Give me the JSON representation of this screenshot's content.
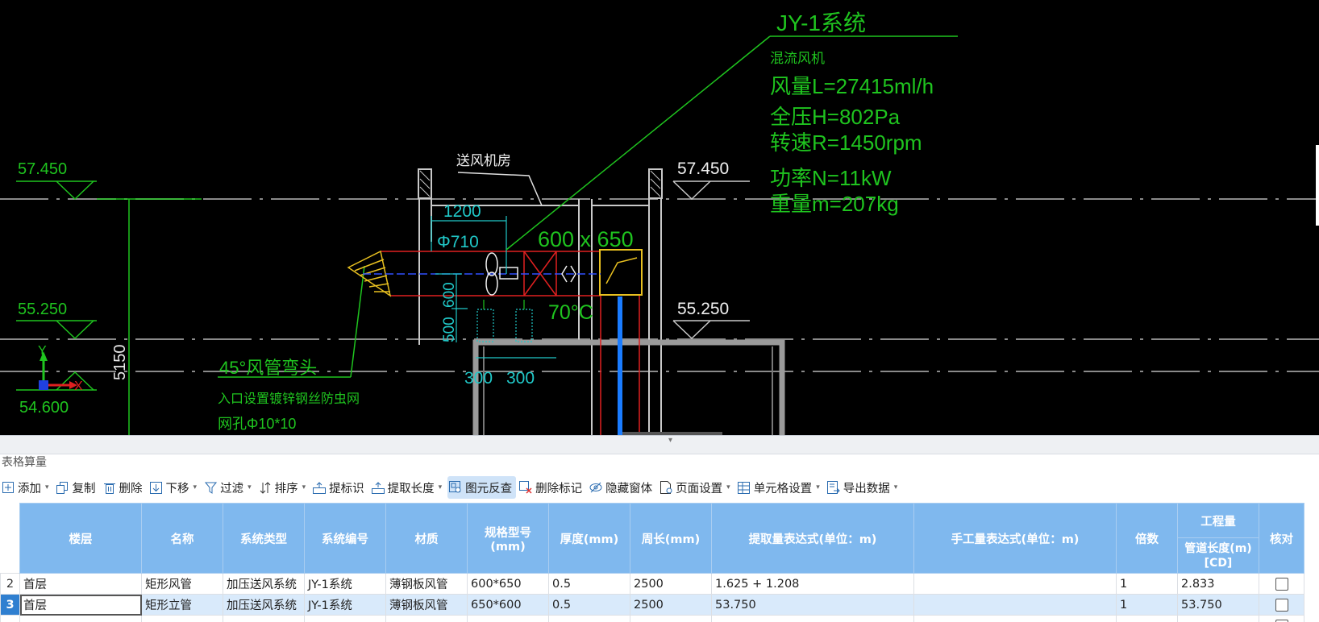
{
  "drawing": {
    "system_title": "JY-1系统",
    "fan_type": "混流风机",
    "airflow": "风量L=27415ml/h",
    "pressure": "全压H=802Pa",
    "speed": "转速R=1450rpm",
    "power": "功率N=11kW",
    "weight": "重量m=207kg",
    "room_label": "送风机房",
    "level_top": "57.450",
    "level_mid": "55.250",
    "level_bot": "54.600",
    "vertical_dim": "5150",
    "dim_1200": "1200",
    "dia_710": "Φ710",
    "duct_size": "600 x 650",
    "dim_600": "600",
    "dim_500": "500",
    "temp_70": "70°C",
    "dim_300a": "300",
    "dim_300b": "300",
    "note_louver": "45°风管弯头",
    "note_inlet": "入口设置镀锌钢丝防虫网",
    "note_mesh": "网孔Φ10*10",
    "axis_y": "Y",
    "axis_x": "X"
  },
  "panel": {
    "title": "表格算量"
  },
  "toolbar": {
    "add": "添加",
    "copy": "复制",
    "delete": "删除",
    "move_down": "下移",
    "filter": "过滤",
    "sort": "排序",
    "extract_mark": "提标识",
    "extract_length": "提取长度",
    "reverse_lookup": "图元反查",
    "delete_mark": "删除标记",
    "hide_window": "隐藏窗体",
    "page_setup": "页面设置",
    "cell_setup": "单元格设置",
    "export_data": "导出数据"
  },
  "table": {
    "headers": {
      "floor": "楼层",
      "name": "名称",
      "system_type": "系统类型",
      "system_no": "系统编号",
      "material": "材质",
      "spec": "规格型号(mm)",
      "thickness": "厚度(mm)",
      "perimeter": "周长(mm)",
      "extract_expr": "提取量表达式(单位：m)",
      "manual_expr": "手工量表达式(单位：m)",
      "multiplier": "倍数",
      "quantity_group": "工程量",
      "pipe_length": "管道长度(m)",
      "pipe_length_code": "[CD]",
      "check": "核对"
    },
    "rows": [
      {
        "no": "2",
        "floor": "首层",
        "name": "矩形风管",
        "system_type": "加压送风系统",
        "system_no": "JY-1系统",
        "material": "薄钢板风管",
        "spec": "600*650",
        "thickness": "0.5",
        "perimeter": "2500",
        "extract_expr": "1.625 + 1.208",
        "manual_expr": "",
        "multiplier": "1",
        "pipe_length": "2.833"
      },
      {
        "no": "3",
        "floor": "首层",
        "name": "矩形立管",
        "system_type": "加压送风系统",
        "system_no": "JY-1系统",
        "material": "薄钢板风管",
        "spec": "650*600",
        "thickness": "0.5",
        "perimeter": "2500",
        "extract_expr": "53.750",
        "manual_expr": "",
        "multiplier": "1",
        "pipe_length": "53.750"
      }
    ]
  }
}
